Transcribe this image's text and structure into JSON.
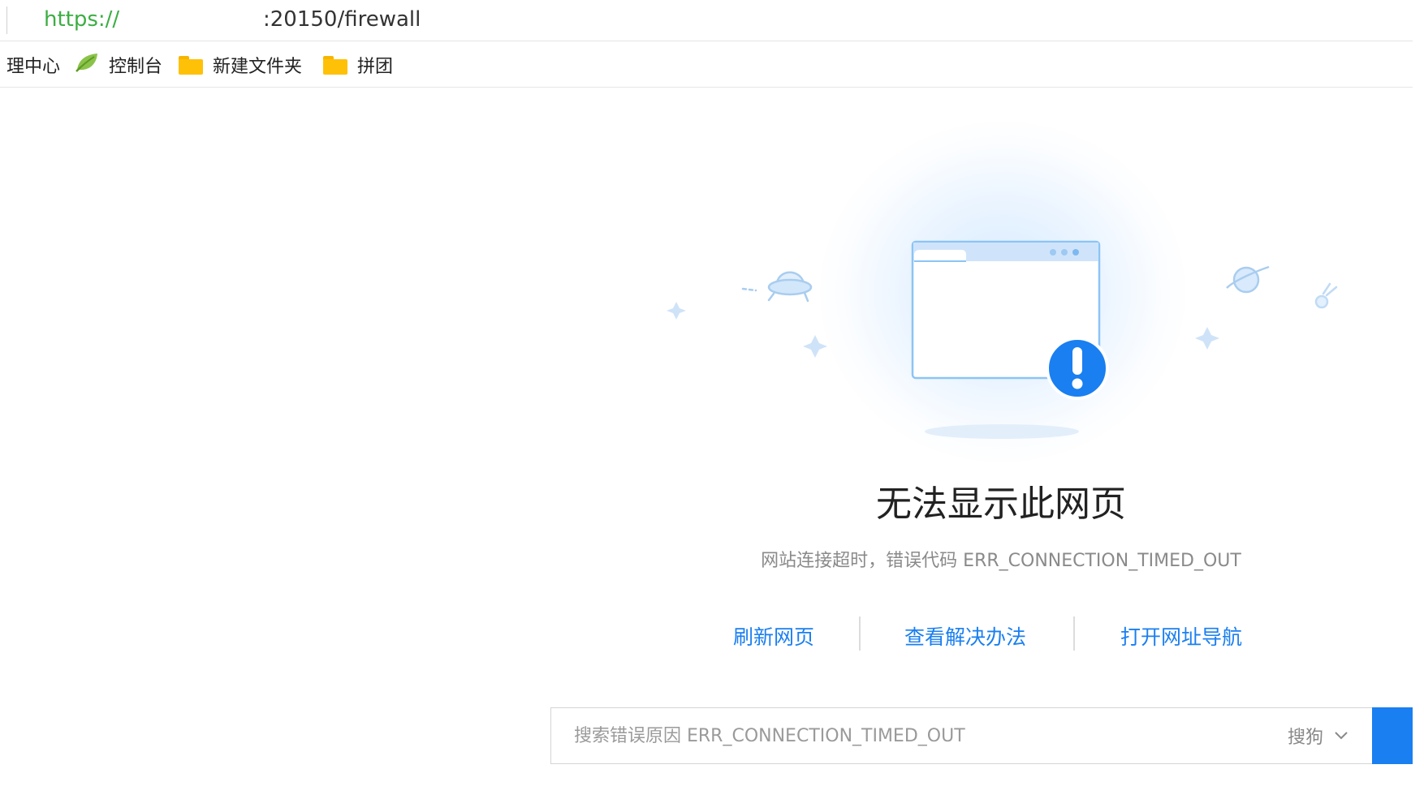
{
  "address_bar": {
    "scheme": "https://",
    "rest": ":20150/firewall"
  },
  "bookmarks": [
    {
      "label": "理中心",
      "icon": "none"
    },
    {
      "label": "控制台",
      "icon": "leaf-icon"
    },
    {
      "label": "新建文件夹",
      "icon": "folder-icon"
    },
    {
      "label": "拼团",
      "icon": "folder-icon"
    }
  ],
  "error_page": {
    "title": "无法显示此网页",
    "description": "网站连接超时，错误代码 ERR_CONNECTION_TIMED_OUT",
    "actions": [
      {
        "label": "刷新网页"
      },
      {
        "label": "查看解决办法"
      },
      {
        "label": "打开网址导航"
      }
    ],
    "search": {
      "placeholder": "搜索错误原因 ERR_CONNECTION_TIMED_OUT",
      "engine": "搜狗"
    }
  },
  "colors": {
    "accent": "#1a7ff0",
    "scheme_green": "#3cae43",
    "folder": "#ffc107",
    "illustration_blue": "#8cc4f5",
    "alert_blue": "#1a7ff0"
  }
}
